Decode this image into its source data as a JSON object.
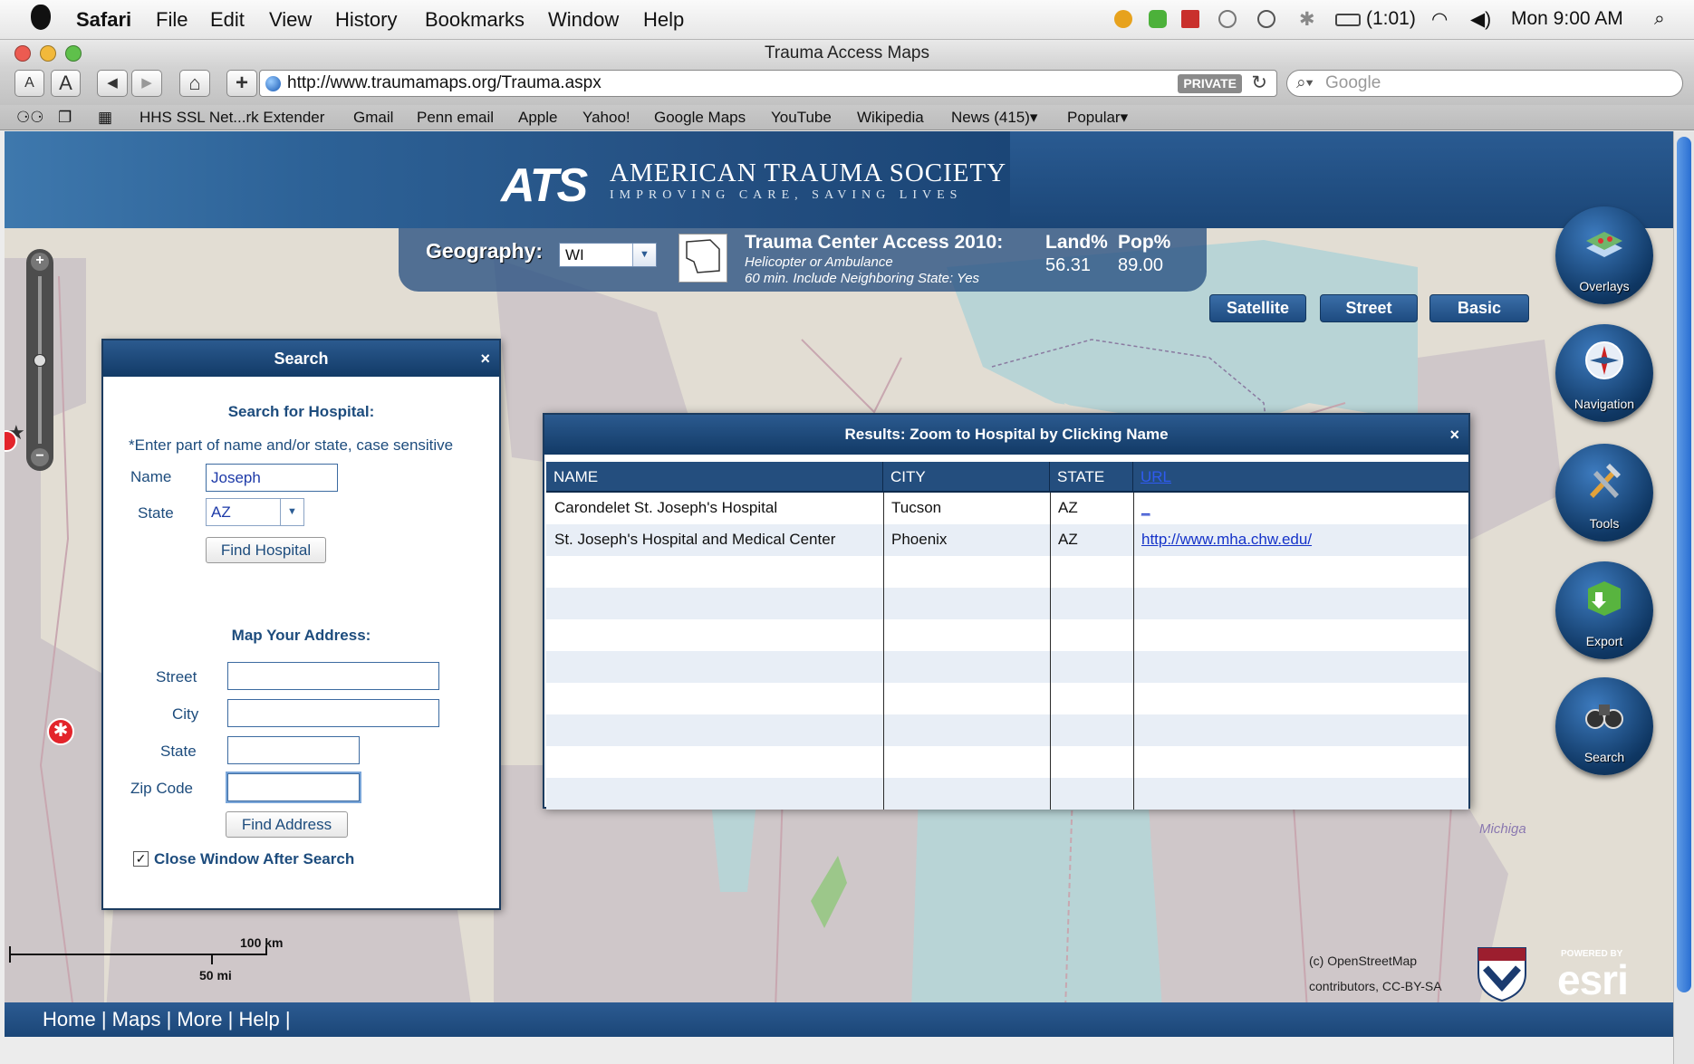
{
  "menubar": {
    "app": "Safari",
    "menus": [
      "File",
      "Edit",
      "View",
      "History",
      "Bookmarks",
      "Window",
      "Help"
    ],
    "battery": "(1:01)",
    "clock": "Mon 9:00 AM"
  },
  "window": {
    "title": "Trauma Access Maps"
  },
  "toolbar": {
    "font_small": "A",
    "font_large": "A",
    "back": "◀",
    "forward": "▶",
    "home": "⌂",
    "add": "+",
    "url": "http://www.traumamaps.org/Trauma.aspx",
    "private": "PRIVATE",
    "search_placeholder": "Google"
  },
  "bookmarks": [
    "HHS SSL Net...rk Extender",
    "Gmail",
    "Penn email",
    "Apple",
    "Yahoo!",
    "Google Maps",
    "YouTube",
    "Wikipedia",
    "News (415)▾",
    "Popular▾"
  ],
  "banner": {
    "logo": "ATS",
    "name": "AMERICAN TRAUMA SOCIETY",
    "tagline": "IMPROVING CARE, SAVING LIVES"
  },
  "geo": {
    "label": "Geography:",
    "selected": "WI",
    "title": "Trauma Center Access 2010:",
    "line1": "Helicopter or Ambulance",
    "line2": "60 min. Include Neighboring State: Yes",
    "land_label": "Land%",
    "pop_label": "Pop%",
    "land_value": "56.31",
    "pop_value": "89.00"
  },
  "basemaps": [
    "Satellite",
    "Street",
    "Basic"
  ],
  "round_buttons": [
    "Overlays",
    "Navigation",
    "Tools",
    "Export",
    "Search"
  ],
  "zoom": {
    "plus": "+",
    "minus": "−",
    "level": 0.5
  },
  "search_win": {
    "title": "Search",
    "close": "×",
    "hospital_heading": "Search for Hospital:",
    "hint": "*Enter part of name and/or state, case sensitive",
    "name_label": "Name",
    "name_value": "Joseph",
    "state_label": "State",
    "state_value": "AZ",
    "find_hospital": "Find Hospital",
    "address_heading": "Map Your Address:",
    "street_label": "Street",
    "city_label": "City",
    "state2_label": "State",
    "zip_label": "Zip Code",
    "find_address": "Find Address",
    "close_after": "Close Window After Search"
  },
  "results_win": {
    "title": "Results: Zoom to Hospital by Clicking Name",
    "close": "×",
    "columns": [
      "NAME",
      "CITY",
      "STATE",
      "URL"
    ],
    "rows": [
      {
        "name": "Carondelet St. Joseph's Hospital",
        "city": "Tucson",
        "state": "AZ",
        "url": "_"
      },
      {
        "name": "St. Joseph's Hospital and Medical Center",
        "city": "Phoenix",
        "state": "AZ",
        "url": "http://www.mha.chw.edu/"
      }
    ]
  },
  "map": {
    "scale_km": "100 km",
    "scale_mi": "50 mi",
    "attribution_1": "(c) OpenStreetMap",
    "attribution_2": "contributors, CC-BY-SA",
    "place_label": "Michiga",
    "powered_by": "POWERED BY",
    "esri": "esri"
  },
  "footer": {
    "links": [
      "Home",
      "Maps",
      "More",
      "Help"
    ]
  },
  "colors": {
    "banner": "#1b4677",
    "water": "#b8d4d6",
    "land": "#e2ddd3",
    "coverage": "#c9c0c4",
    "accent_text": "#1d4c7d"
  }
}
